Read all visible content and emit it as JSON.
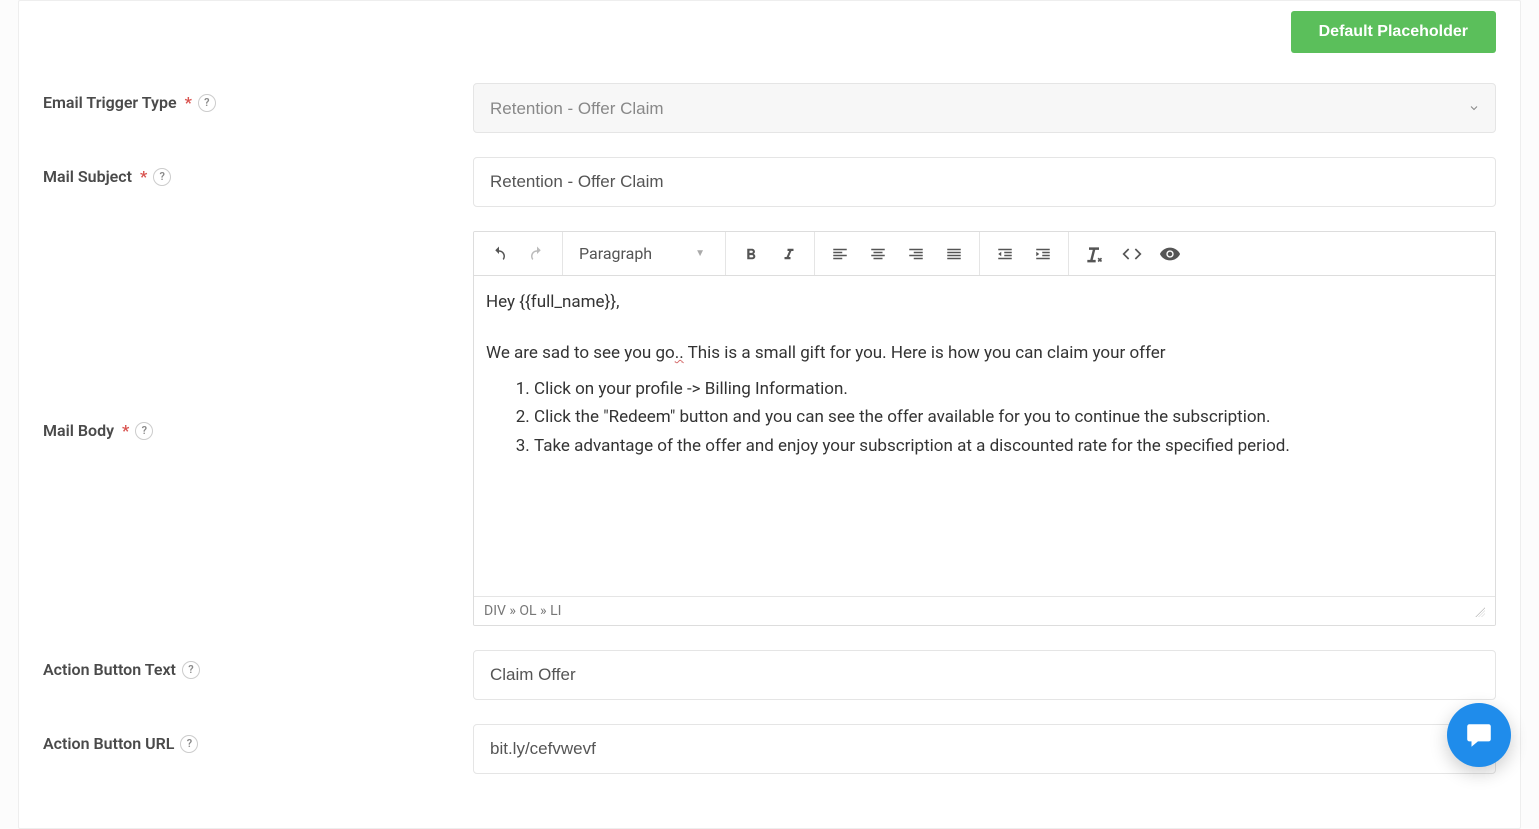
{
  "topbar": {
    "default_placeholder_label": "Default Placeholder"
  },
  "form": {
    "trigger_type": {
      "label": "Email Trigger Type",
      "selected": "Retention - Offer Claim"
    },
    "mail_subject": {
      "label": "Mail Subject",
      "value": "Retention - Offer Claim"
    },
    "mail_body": {
      "label": "Mail Body",
      "paragraph_label": "Paragraph",
      "greeting": "Hey {{full_name}},",
      "intro_pre": "We are sad to see you go",
      "intro_mid": "..",
      "intro_post": " This is a small gift for you. Here is how you can claim your offer",
      "steps": [
        "Click on your profile ->  Billing Information.",
        "Click the \"Redeem\" button and you can see the offer available for you to continue the subscription.",
        "Take advantage of the offer and enjoy your subscription at a discounted rate for the specified period."
      ],
      "breadcrumb": "DIV » OL » LI"
    },
    "action_text": {
      "label": "Action Button Text",
      "value": "Claim Offer"
    },
    "action_url": {
      "label": "Action Button URL",
      "value": "bit.ly/cefvwevf"
    }
  }
}
